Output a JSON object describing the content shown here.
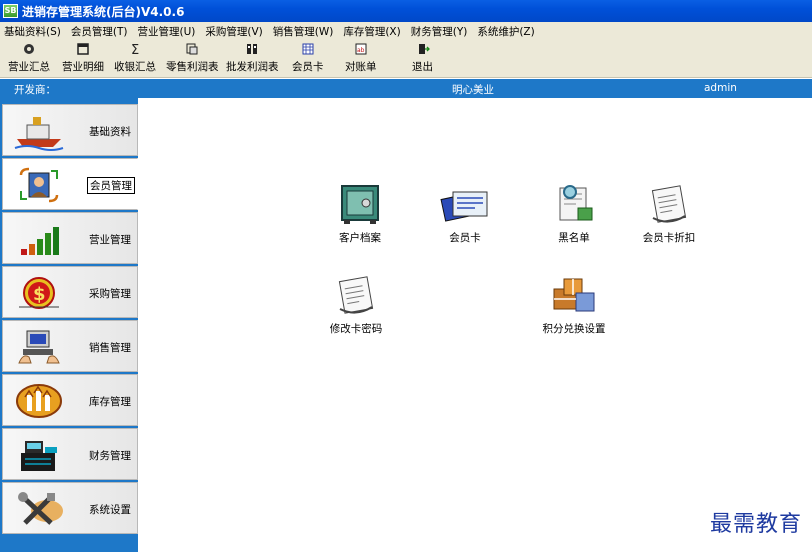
{
  "window": {
    "title": "进销存管理系统(后台)V4.0.6"
  },
  "menu": [
    "基础资料(S)",
    "会员管理(T)",
    "营业管理(U)",
    "采购管理(V)",
    "销售管理(W)",
    "库存管理(X)",
    "财务管理(Y)",
    "系统维护(Z)"
  ],
  "toolbar": {
    "business_summary": "营业汇总",
    "business_detail": "营业明细",
    "cash_summary": "收银汇总",
    "retail_profit": "零售利润表",
    "wholesale_profit": "批发利润表",
    "member_card": "会员卡",
    "statement": "对账单",
    "exit": "退出"
  },
  "infobar": {
    "developer_label": "开发商：",
    "company": "明心美业",
    "user": "admin"
  },
  "sidebar": {
    "items": [
      {
        "label": "基础资料",
        "icon": "ship-icon"
      },
      {
        "label": "会员管理",
        "icon": "member-cycle-icon",
        "active": true
      },
      {
        "label": "营业管理",
        "icon": "bar-chart-icon"
      },
      {
        "label": "采购管理",
        "icon": "dollar-icon"
      },
      {
        "label": "销售管理",
        "icon": "computer-hands-icon"
      },
      {
        "label": "库存管理",
        "icon": "warehouse-arrows-icon"
      },
      {
        "label": "财务管理",
        "icon": "cash-register-icon"
      },
      {
        "label": "系统设置",
        "icon": "tools-icon"
      }
    ]
  },
  "functions": {
    "customer_file": "客户档案",
    "member_card": "会员卡",
    "blacklist": "黑名单",
    "card_discount": "会员卡折扣",
    "change_password": "修改卡密码",
    "points_exchange": "积分兑换设置"
  },
  "watermark": "最需教育",
  "colors": {
    "titlebar": "#0050d8",
    "infobar": "#1e78c8",
    "menubar": "#ece9d8"
  }
}
